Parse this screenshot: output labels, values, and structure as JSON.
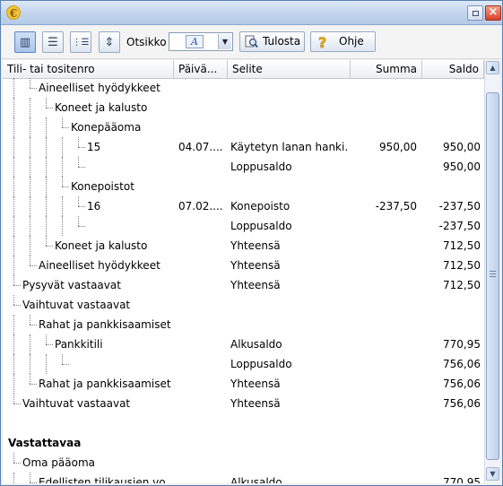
{
  "window": {
    "app_icon": "€"
  },
  "toolbar": {
    "view_buttons": [
      {
        "name": "columns-view-icon",
        "glyph": "▥"
      },
      {
        "name": "list-view-icon",
        "glyph": "☰"
      },
      {
        "name": "tree-view-icon",
        "glyph": "⋮☰"
      },
      {
        "name": "expand-collapse-icon",
        "glyph": "⇕"
      }
    ],
    "heading_label": "Otsikko",
    "font_glyph": "A",
    "print_label": "Tulosta",
    "help_label": "Ohje"
  },
  "table": {
    "columns": [
      "Tili- tai tositenro",
      "Päivä...",
      "Selite",
      "Summa",
      "Saldo"
    ],
    "rows": [
      {
        "level": 1,
        "account": "Aineelliset hyödykkeet",
        "date": "",
        "desc": "",
        "amount": "",
        "balance": ""
      },
      {
        "level": 2,
        "account": "Koneet ja kalusto",
        "date": "",
        "desc": "",
        "amount": "",
        "balance": ""
      },
      {
        "level": 3,
        "account": "Konepääoma",
        "date": "",
        "desc": "",
        "amount": "",
        "balance": ""
      },
      {
        "level": 4,
        "account": "15",
        "date": "04.07....",
        "desc": "Käytetyn lanan hanki...",
        "amount": "950,00",
        "balance": "950,00"
      },
      {
        "level": 4,
        "account": "",
        "date": "",
        "desc": "Loppusaldo",
        "amount": "",
        "balance": "950,00"
      },
      {
        "level": 3,
        "account": "Konepoistot",
        "date": "",
        "desc": "",
        "amount": "",
        "balance": ""
      },
      {
        "level": 4,
        "account": "16",
        "date": "07.02....",
        "desc": "Konepoisto",
        "amount": "-237,50",
        "balance": "-237,50"
      },
      {
        "level": 4,
        "account": "",
        "date": "",
        "desc": "Loppusaldo",
        "amount": "",
        "balance": "-237,50"
      },
      {
        "level": 2,
        "account": "Koneet ja kalusto",
        "date": "",
        "desc": "Yhteensä",
        "amount": "",
        "balance": "712,50"
      },
      {
        "level": 1,
        "account": "Aineelliset hyödykkeet",
        "date": "",
        "desc": "Yhteensä",
        "amount": "",
        "balance": "712,50"
      },
      {
        "level": 0,
        "account": "Pysyvät vastaavat",
        "date": "",
        "desc": "Yhteensä",
        "amount": "",
        "balance": "712,50"
      },
      {
        "level": 0,
        "account": "Vaihtuvat vastaavat",
        "date": "",
        "desc": "",
        "amount": "",
        "balance": ""
      },
      {
        "level": 1,
        "account": "Rahat ja pankkisaamiset",
        "date": "",
        "desc": "",
        "amount": "",
        "balance": ""
      },
      {
        "level": 2,
        "account": "Pankkitili",
        "date": "",
        "desc": "Alkusaldo",
        "amount": "",
        "balance": "770,95"
      },
      {
        "level": 3,
        "account": "",
        "date": "",
        "desc": "Loppusaldo",
        "amount": "",
        "balance": "756,06"
      },
      {
        "level": 1,
        "account": "Rahat ja pankkisaamiset",
        "date": "",
        "desc": "Yhteensä",
        "amount": "",
        "balance": "756,06"
      },
      {
        "level": 0,
        "account": "Vaihtuvat vastaavat",
        "date": "",
        "desc": "Yhteensä",
        "amount": "",
        "balance": "756,06"
      },
      {
        "level": -1,
        "account": "",
        "date": "",
        "desc": "",
        "amount": "",
        "balance": ""
      },
      {
        "level": -1,
        "account": "Vastattavaa",
        "date": "",
        "desc": "",
        "amount": "",
        "balance": "",
        "bold": true
      },
      {
        "level": 0,
        "account": "Oma pääoma",
        "date": "",
        "desc": "",
        "amount": "",
        "balance": ""
      },
      {
        "level": 1,
        "account": "Edellisten tilikausien vo...",
        "date": "",
        "desc": "Alkusaldo",
        "amount": "",
        "balance": "770,95"
      }
    ]
  },
  "scrollbar": {
    "up_arrow": "▲",
    "down_arrow": "▼"
  }
}
